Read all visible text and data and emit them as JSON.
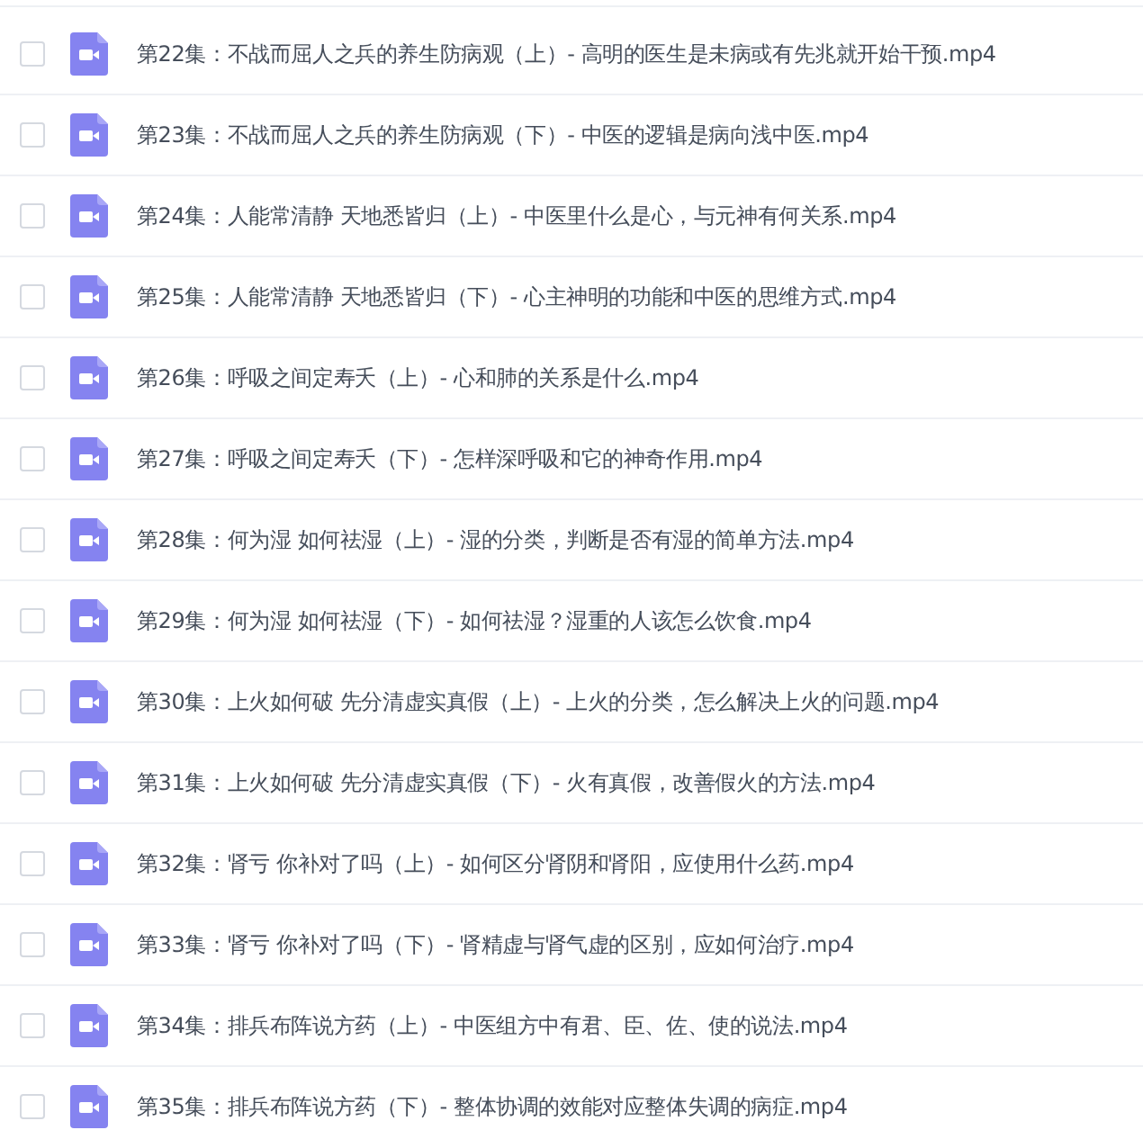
{
  "files": [
    {
      "name": "第22集：不战而屈人之兵的养生防病观（上）- 高明的医生是未病或有先兆就开始干预.mp4",
      "checked": false
    },
    {
      "name": "第23集：不战而屈人之兵的养生防病观（下）- 中医的逻辑是病向浅中医.mp4",
      "checked": false
    },
    {
      "name": "第24集：人能常清静 天地悉皆归（上）- 中医里什么是心，与元神有何关系.mp4",
      "checked": false
    },
    {
      "name": "第25集：人能常清静 天地悉皆归（下）- 心主神明的功能和中医的思维方式.mp4",
      "checked": false
    },
    {
      "name": "第26集：呼吸之间定寿夭（上）- 心和肺的关系是什么.mp4",
      "checked": false
    },
    {
      "name": "第27集：呼吸之间定寿夭（下）- 怎样深呼吸和它的神奇作用.mp4",
      "checked": false
    },
    {
      "name": "第28集：何为湿 如何祛湿（上）- 湿的分类，判断是否有湿的简单方法.mp4",
      "checked": false
    },
    {
      "name": "第29集：何为湿 如何祛湿（下）- 如何祛湿？湿重的人该怎么饮食.mp4",
      "checked": false
    },
    {
      "name": "第30集：上火如何破 先分清虚实真假（上）- 上火的分类，怎么解决上火的问题.mp4",
      "checked": false
    },
    {
      "name": "第31集：上火如何破 先分清虚实真假（下）- 火有真假，改善假火的方法.mp4",
      "checked": false
    },
    {
      "name": "第32集：肾亏 你补对了吗（上）- 如何区分肾阴和肾阳，应使用什么药.mp4",
      "checked": false
    },
    {
      "name": "第33集：肾亏 你补对了吗（下）- 肾精虚与肾气虚的区别，应如何治疗.mp4",
      "checked": false
    },
    {
      "name": "第34集：排兵布阵说方药（上）- 中医组方中有君、臣、佐、使的说法.mp4",
      "checked": false
    },
    {
      "name": "第35集：排兵布阵说方药（下）- 整体协调的效能对应整体失调的病症.mp4",
      "checked": false
    }
  ]
}
